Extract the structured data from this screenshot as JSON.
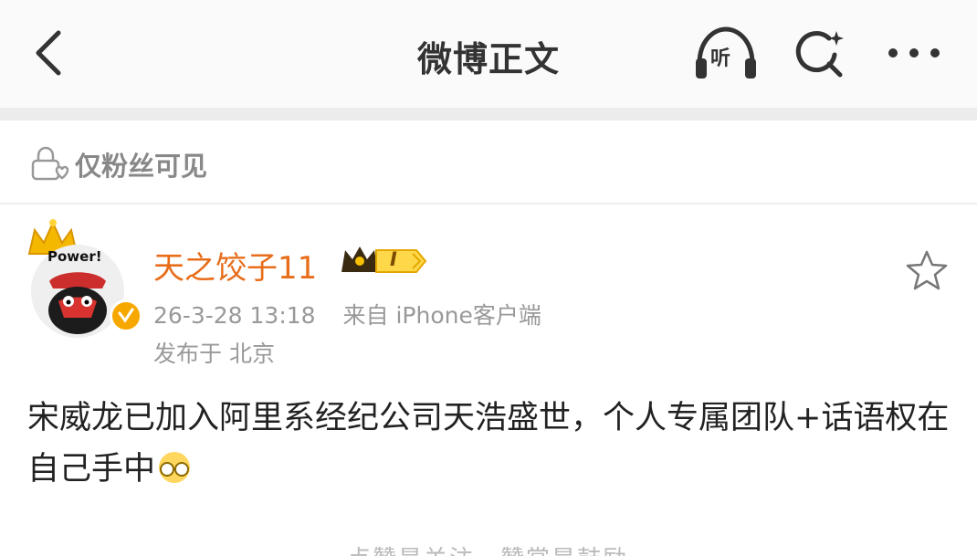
{
  "nav": {
    "title": "微博正文",
    "listen_label": "听"
  },
  "visibility": {
    "label": "仅粉丝可见"
  },
  "author": {
    "avatar_caption": "Power!",
    "name": "天之饺子11",
    "level": "I",
    "time": "26-3-28 13:18",
    "source": "来自 iPhone客户端",
    "location": "发布于 北京"
  },
  "post": {
    "text": "宋威龙已加入阿里系经纪公司天浩盛世，个人专属团队+话语权在自己手中"
  },
  "footer_partial": {
    "text": "点赞是关注，赞赏是鼓励"
  },
  "colors": {
    "username": "#e86d1a",
    "badge_gold": "#f7a800",
    "meta_gray": "#999999"
  }
}
